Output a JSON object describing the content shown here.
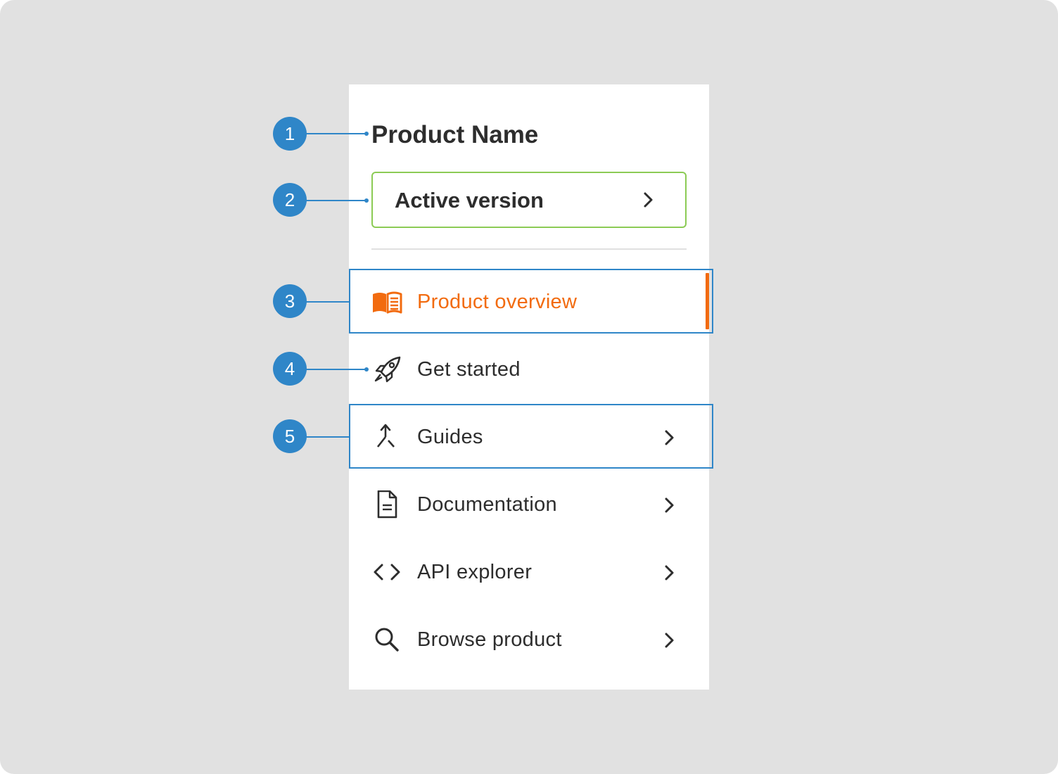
{
  "colors": {
    "background": "#e1e1e1",
    "panel": "#ffffff",
    "text": "#2d2d2d",
    "active": "#f26b0f",
    "version_border": "#8ccb55",
    "callout": "#2f86c8"
  },
  "sidebar": {
    "product_name": "Product Name",
    "version_selector": {
      "label": "Active version",
      "icon": "chevron-right-icon"
    },
    "items": [
      {
        "label": "Product overview",
        "icon": "book-open-icon",
        "active": true,
        "has_submenu": false
      },
      {
        "label": "Get started",
        "icon": "rocket-icon",
        "active": false,
        "has_submenu": false
      },
      {
        "label": "Guides",
        "icon": "merge-arrow-icon",
        "active": false,
        "has_submenu": true
      },
      {
        "label": "Documentation",
        "icon": "document-icon",
        "active": false,
        "has_submenu": true
      },
      {
        "label": "API explorer",
        "icon": "code-brackets-icon",
        "active": false,
        "has_submenu": true
      },
      {
        "label": "Browse product",
        "icon": "search-icon",
        "active": false,
        "has_submenu": true
      }
    ]
  },
  "callouts": [
    {
      "number": "1",
      "target": "product-name"
    },
    {
      "number": "2",
      "target": "version-selector"
    },
    {
      "number": "3",
      "target": "nav-item-product-overview"
    },
    {
      "number": "4",
      "target": "get-started-icon"
    },
    {
      "number": "5",
      "target": "nav-item-guides"
    }
  ]
}
